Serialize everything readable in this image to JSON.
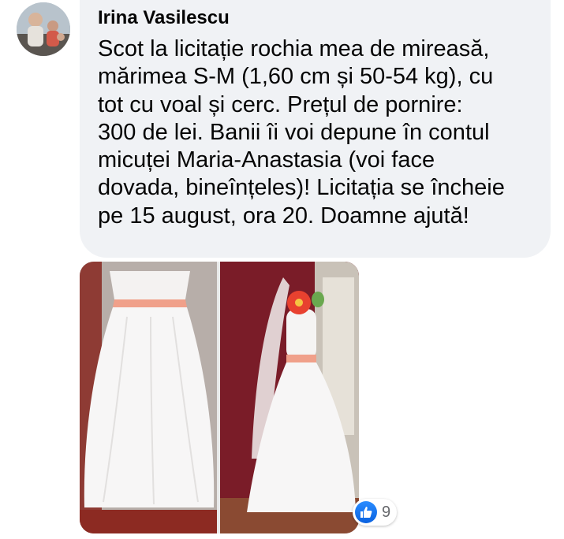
{
  "comment": {
    "author": "Irina Vasilescu",
    "lines": [
      "Scot la licitație rochia mea de mireasă,",
      "mărimea S-M (1,60 cm și 50-54 kg), cu",
      "tot cu voal și cerc. Prețul de pornire:",
      "300 de lei. Banii îi voi depune în contul",
      "micuței Maria-Anastasia (voi face",
      "dovada, bineînțeles)! Licitația se încheie",
      "pe 15 august, ora 20. Doamne ajută!"
    ]
  },
  "reactions": {
    "icon": "thumbs-up-icon",
    "count": "9",
    "color": "#1877f2"
  },
  "colors": {
    "bubble": "#f0f2f5",
    "text": "#050505",
    "sash": "#f0a08a"
  }
}
